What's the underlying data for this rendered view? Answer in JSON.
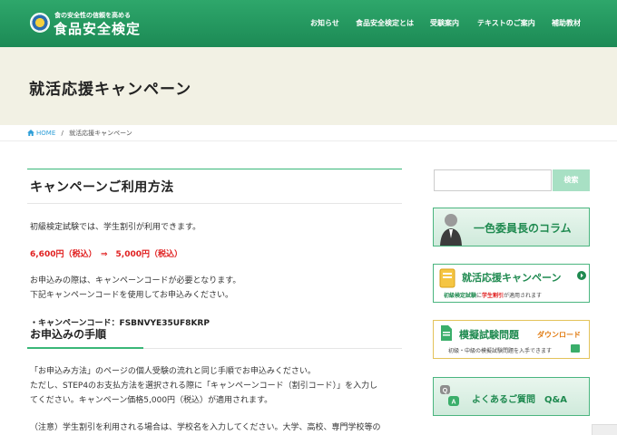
{
  "header": {
    "logo_tagline": "食の安全性の信頼を高める",
    "logo_name": "食品安全検定",
    "nav": [
      "お知らせ",
      "食品安全検定とは",
      "受験案内",
      "テキストのご案内",
      "補助教材"
    ]
  },
  "page_title": "就活応援キャンペーン",
  "breadcrumb": {
    "home": "HOME",
    "separator": "/",
    "current": "就活応援キャンペーン"
  },
  "main": {
    "heading": "キャンペーンご利用方法",
    "intro": "初級検定試験では、学生割引が利用できます。",
    "price": "6,600円（税込）　⇒　5,000円（税込）",
    "code_need_1": "お申込みの際は、キャンペーンコードが必要となります。",
    "code_need_2": "下記キャンペーンコードを使用してお申込みください。",
    "code_line": "・キャンペーンコード：FSBNVYE35UF8KRP",
    "subheading": "お申込みの手順",
    "step_1": "「お申込み方法」のページの個人受験の流れと同じ手順でお申込みください。",
    "step_2": "ただし、STEP4のお支払方法を選択される際に「キャンペーンコード（割引コード）」を入力し",
    "step_3": "てください。キャンペーン価格5,000円（税込）が適用されます。",
    "note": "（注意）学生割引を利用される場合は、学校名を入力してください。大学、高校、専門学校等の"
  },
  "sidebar": {
    "search_button": "検索",
    "banner_column": "一色委員長のコラム",
    "banner_campaign": "就活応援キャンペーン",
    "banner_campaign_sub_pre": "初級検定試験",
    "banner_campaign_sub_mid": "に",
    "banner_campaign_sub_red": "学生割引",
    "banner_campaign_sub_post": "が適用されます",
    "banner_mock": "模擬試験問題",
    "banner_mock_dl": "ダウンロード",
    "banner_mock_sub": "初級・中級の模擬試験問題を入手できます",
    "banner_faq": "よくあるご質問　Q&A"
  },
  "colors": {
    "brand_green": "#1c8a55",
    "accent_green": "#39b778",
    "price_red": "#e02020",
    "link_blue": "#2f9fd8"
  },
  "icons": [
    "emblem-logo",
    "home-icon",
    "person-portrait",
    "book-icon",
    "document-icon",
    "qa-bubbles-icon"
  ]
}
